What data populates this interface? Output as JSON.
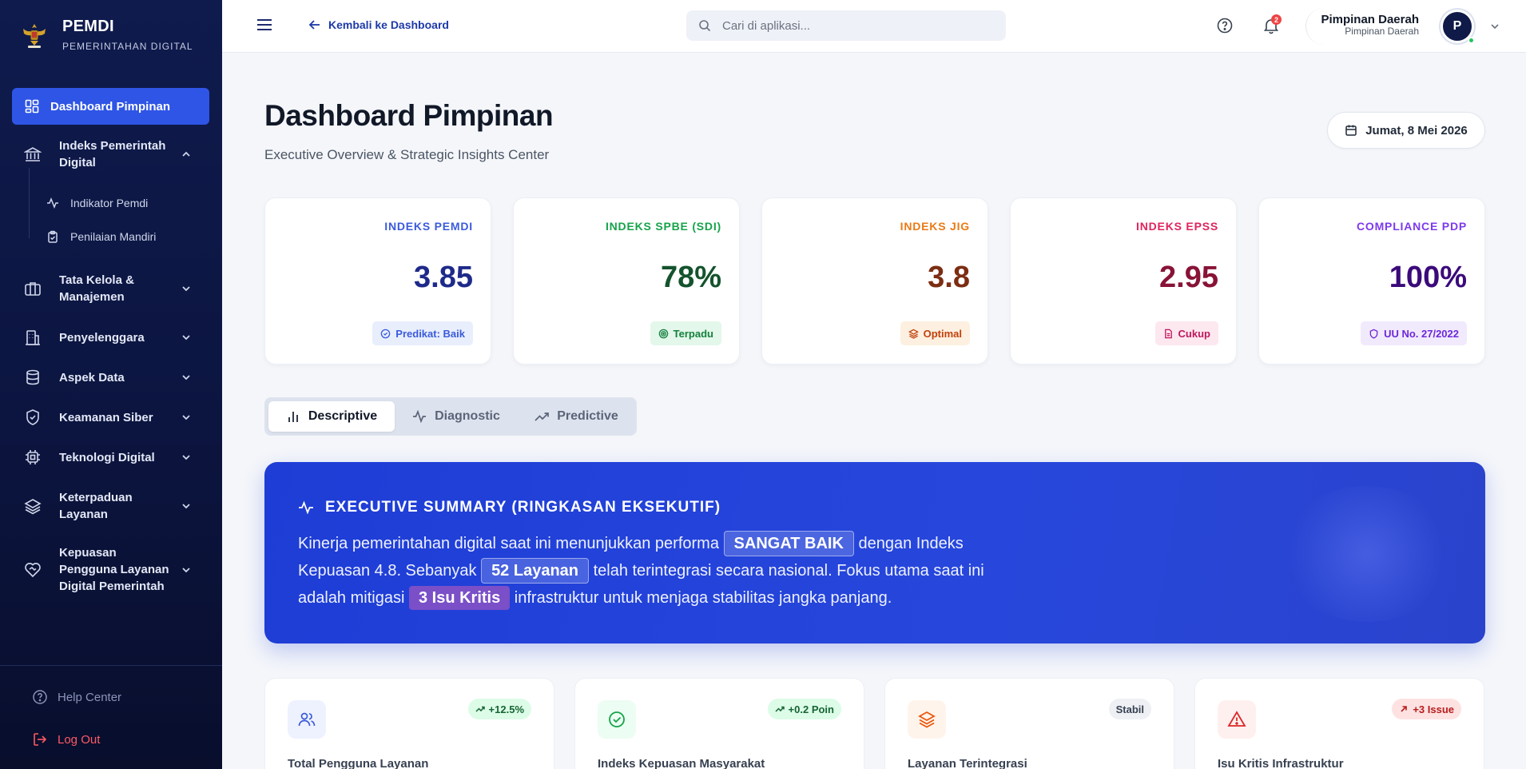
{
  "brand": {
    "title": "PEMDI",
    "subtitle": "PEMERINTAHAN DIGITAL"
  },
  "sidebar": {
    "active": "Dashboard Pimpinan",
    "items": [
      {
        "label": "Indeks Pemerintah Digital",
        "icon": "bank-icon",
        "expanded": true
      },
      {
        "label": "Tata Kelola & Manajemen",
        "icon": "briefcase-icon"
      },
      {
        "label": "Penyelenggara",
        "icon": "building-icon"
      },
      {
        "label": "Aspek Data",
        "icon": "database-icon"
      },
      {
        "label": "Keamanan Siber",
        "icon": "shield-icon"
      },
      {
        "label": "Teknologi Digital",
        "icon": "cpu-icon"
      },
      {
        "label": "Keterpaduan Layanan",
        "icon": "layers-icon"
      },
      {
        "label": "Kepuasan Pengguna Layanan Digital Pemerintah",
        "icon": "heart-handshake-icon"
      }
    ],
    "subitems": [
      {
        "label": "Indikator Pemdi",
        "icon": "activity-icon"
      },
      {
        "label": "Penilaian Mandiri",
        "icon": "clipboard-check-icon"
      }
    ],
    "help": "Help Center",
    "logout": "Log Out"
  },
  "header": {
    "back_label": "Kembali ke Dashboard",
    "search_placeholder": "Cari di aplikasi...",
    "notif_count": "2",
    "user_name": "Pimpinan Daerah",
    "user_role": "Pimpinan Daerah",
    "avatar_initial": "P"
  },
  "main": {
    "title": "Dashboard Pimpinan",
    "subtitle": "Executive Overview & Strategic Insights Center",
    "date": "Jumat, 8 Mei 2026",
    "kpis": [
      {
        "label": "INDEKS PEMDI",
        "value": "3.85",
        "badge": "Predikat: Baik",
        "label_color": "#3b5bdb",
        "value_color": "#1e2a8a",
        "badge_bg": "#e8eefc",
        "badge_color": "#3b5bdb"
      },
      {
        "label": "INDEKS SPBE (SDI)",
        "value": "78%",
        "badge": "Terpadu",
        "label_color": "#16a34a",
        "value_color": "#14532d",
        "badge_bg": "#e3f7ea",
        "badge_color": "#15803d"
      },
      {
        "label": "INDEKS JIG",
        "value": "3.8",
        "badge": "Optimal",
        "label_color": "#ea7a16",
        "value_color": "#7c2d12",
        "badge_bg": "#fdf0e0",
        "badge_color": "#c2410c"
      },
      {
        "label": "INDEKS EPSS",
        "value": "2.95",
        "badge": "Cukup",
        "label_color": "#e0245e",
        "value_color": "#881337",
        "badge_bg": "#fde8ef",
        "badge_color": "#be185d"
      },
      {
        "label": "COMPLIANCE PDP",
        "value": "100%",
        "badge": "UU No. 27/2022",
        "label_color": "#7c3aed",
        "value_color": "#3b0a7a",
        "badge_bg": "#f1eafd",
        "badge_color": "#6d28d9"
      }
    ],
    "tabs": [
      "Descriptive",
      "Diagnostic",
      "Predictive"
    ],
    "active_tab": "Descriptive",
    "summary": {
      "heading": "EXECUTIVE SUMMARY (RINGKASAN EKSEKUTIF)",
      "part1": "Kinerja pemerintahan digital saat ini menunjukkan performa ",
      "hl1": "SANGAT BAIK",
      "part2": " dengan Indeks Kepuasan 4.8. Sebanyak ",
      "hl2": "52 Layanan",
      "part3": " telah terintegrasi secara nasional. Fokus utama saat ini adalah mitigasi ",
      "hl3": "3 Isu Kritis",
      "part4": " infrastruktur untuk menjaga stabilitas jangka panjang."
    },
    "cards": [
      {
        "title": "Total Pengguna Layanan",
        "chip": "+12.5%",
        "icon": "users-icon",
        "chip_bg": "#dcfce7",
        "chip_color": "#166534",
        "icon_bg": "#eef2ff",
        "icon_color": "#3b5bdb"
      },
      {
        "title": "Indeks Kepuasan Masyarakat",
        "chip": "+0.2 Poin",
        "icon": "check-circle-icon",
        "chip_bg": "#dcfce7",
        "chip_color": "#166534",
        "icon_bg": "#ecfdf3",
        "icon_color": "#16a34a"
      },
      {
        "title": "Layanan Terintegrasi",
        "chip": "Stabil",
        "icon": "layers-icon",
        "chip_bg": "#eef0f4",
        "chip_color": "#374151",
        "icon_bg": "#fff4ec",
        "icon_color": "#ea580c"
      },
      {
        "title": "Isu Kritis Infrastruktur",
        "chip": "+3 Issue",
        "icon": "alert-triangle-icon",
        "chip_bg": "#fee2e2",
        "chip_color": "#b91c1c",
        "icon_bg": "#fff0f0",
        "icon_color": "#dc2626"
      }
    ]
  }
}
